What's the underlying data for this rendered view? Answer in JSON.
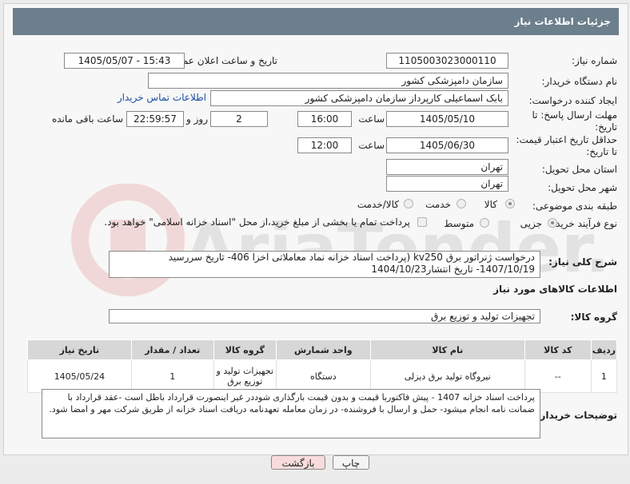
{
  "header": {
    "title": "جزئیات اطلاعات نیاز"
  },
  "form": {
    "need_number_label": "شماره نیاز:",
    "need_number": "1105003023000110",
    "announce_label": "تاریخ و ساعت اعلان عمومی:",
    "announce_value": "1405/05/07 - 15:43",
    "buyer_org_label": "نام دستگاه خریدار:",
    "buyer_org": "سازمان دامپزشکی کشور",
    "creator_label": "ایجاد کننده درخواست:",
    "creator": "بابک اسماعیلی کارپرداز سازمان دامپزشکی کشور",
    "contact_link": "اطلاعات تماس خریدار",
    "deadline_label_1": "مهلت ارسال پاسخ: تا",
    "deadline_label_2": "تاریخ:",
    "deadline_date": "1405/05/10",
    "time_label": "ساعت",
    "deadline_time": "16:00",
    "days_value": "2",
    "days_label": "روز و",
    "remaining_time": "22:59:57",
    "remaining_label": "ساعت باقی مانده",
    "validity_label_1": "حداقل تاریخ اعتبار قیمت:",
    "validity_label_2": "تا تاریخ:",
    "validity_date": "1405/06/30",
    "validity_time": "12:00",
    "province_label": "استان محل تحویل:",
    "province": "تهران",
    "city_label": "شهر محل تحویل:",
    "city": "تهران",
    "category_label": "طبقه بندی موضوعی:",
    "category_options": [
      "کالا",
      "خدمت",
      "کالا/خدمت"
    ],
    "category_selected": "کالا",
    "process_label": "نوع فرآیند خرید :",
    "process_options": [
      "جزیی",
      "متوسط"
    ],
    "process_selected": "جزیی",
    "treasury_note": "پرداخت تمام یا بخشی از مبلغ خرید،از محل \"اسناد خزانه اسلامی\" خواهد بود."
  },
  "description": {
    "label": "شرح کلی نیاز:",
    "text": "درخواست ژنراتور برق kv250 (پرداخت  اسناد خزانه نماد معاملاتی اخزا 406- تاریخ سررسید 1407/10/19- تاریخ انتشار1404/10/23"
  },
  "goods_section": {
    "title": "اطلاعات کالاهای مورد نیاز",
    "group_label": "گروه کالا:",
    "group_value": "تجهیزات تولید و توزیع برق"
  },
  "table": {
    "headers": [
      "ردیف",
      "کد کالا",
      "نام کالا",
      "واحد شمارش",
      "گروه کالا",
      "تعداد / مقدار",
      "تاریخ نیاز"
    ],
    "rows": [
      [
        "1",
        "--",
        "نیروگاه تولید برق دیزلی",
        "دستگاه",
        "تجهیزات تولید و توزیع برق",
        "1",
        "1405/05/24"
      ]
    ]
  },
  "buyer_notes": {
    "label": "توضیحات خریدار:",
    "text": "پرداخت اسناد خزانه 1407 - پیش فاکتوربا قیمت و بدون قیمت  بارگذاری شوددر غیر اینصورت قرارداد باطل است -عقد قرارداد با ضمانت نامه انجام میشود- حمل و ارسال با فروشنده- در زمان معامله تعهدنامه دریافت اسناد خزانه از طریق شرکت مهر و امضا شود."
  },
  "buttons": {
    "print": "چاپ",
    "back": "بازگشت"
  },
  "watermark": "AriaTender.net"
}
